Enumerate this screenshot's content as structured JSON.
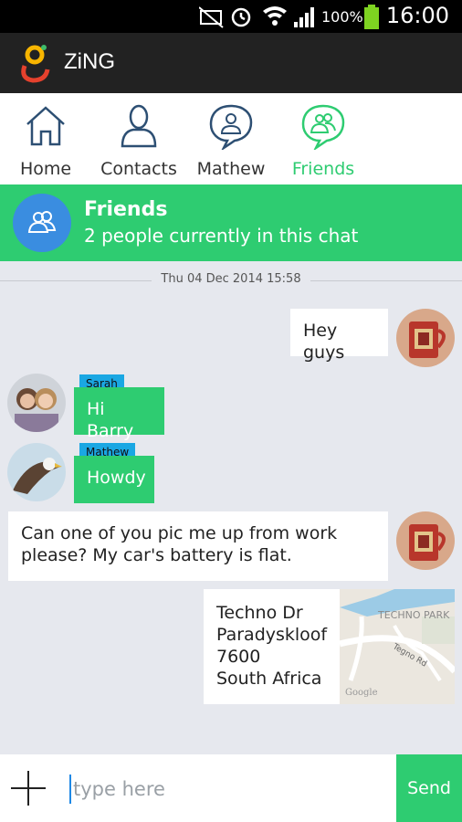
{
  "status_bar": {
    "battery_percent": "100%",
    "time": "16:00"
  },
  "app": {
    "title": "ZiNG"
  },
  "tabs": [
    {
      "label": "Home",
      "icon": "home-icon"
    },
    {
      "label": "Contacts",
      "icon": "contact-icon"
    },
    {
      "label": "Mathew",
      "icon": "chat-person-icon"
    },
    {
      "label": "Friends",
      "icon": "group-chat-icon",
      "active": true
    }
  ],
  "chat_header": {
    "title": "Friends",
    "subtitle": "2 people currently in this chat"
  },
  "date_separator": "Thu 04 Dec 2014 15:58",
  "messages": [
    {
      "sender": "",
      "text": "Hey guys",
      "outgoing": true
    },
    {
      "sender": "Sarah",
      "text": "Hi Barry",
      "outgoing": false
    },
    {
      "sender": "Mathew",
      "text": "Howdy",
      "outgoing": false
    },
    {
      "sender": "",
      "text": "Can one of you pic me up from work please? My car's battery is flat.",
      "outgoing": true
    },
    {
      "sender": "",
      "address": [
        "Techno Dr",
        "Paradyskloof",
        "7600",
        "South Africa"
      ],
      "map_labels": [
        "TECHNO PARK",
        "Tegno Rd",
        "Google"
      ],
      "outgoing": true
    }
  ],
  "composer": {
    "placeholder": "type here",
    "send_label": "Send"
  },
  "colors": {
    "accent": "#2ecc71",
    "tag": "#1aa7e3",
    "header_avatar": "#3a8de0"
  }
}
